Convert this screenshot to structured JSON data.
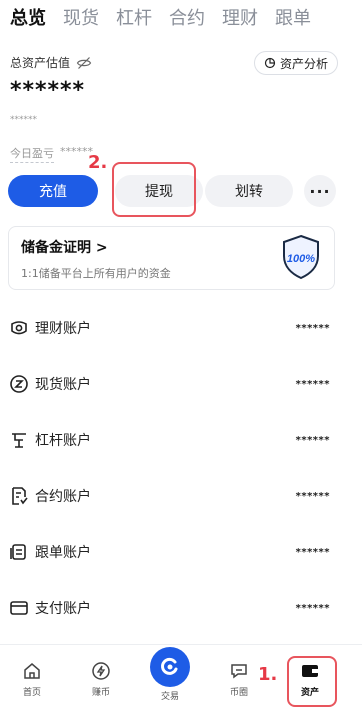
{
  "tabs": [
    "总览",
    "现货",
    "杠杆",
    "合约",
    "理财",
    "跟单"
  ],
  "summary": {
    "label": "总资产估值",
    "masked_total": "******",
    "masked_sub": "******",
    "pnl_label": "今日盈亏",
    "pnl_value": "******",
    "analysis_button": "资产分析"
  },
  "actions": {
    "recharge": "充值",
    "withdraw": "提现",
    "transfer": "划转",
    "more": "···"
  },
  "annotations": {
    "step1": "1.",
    "step2": "2."
  },
  "reserve": {
    "title": "储备金证明 >",
    "desc": "1:1储备平台上所有用户的资金",
    "badge": "100%"
  },
  "accounts": [
    {
      "label": "理财账户",
      "value": "******",
      "icon": "wealth-icon"
    },
    {
      "label": "现货账户",
      "value": "******",
      "icon": "spot-icon"
    },
    {
      "label": "杠杆账户",
      "value": "******",
      "icon": "margin-icon"
    },
    {
      "label": "合约账户",
      "value": "******",
      "icon": "futures-icon"
    },
    {
      "label": "跟单账户",
      "value": "******",
      "icon": "copytrade-icon"
    },
    {
      "label": "支付账户",
      "value": "******",
      "icon": "payment-icon"
    }
  ],
  "nav": {
    "home": "首页",
    "earn": "赚币",
    "trade": "交易",
    "community": "币圈",
    "assets": "资产"
  },
  "colors": {
    "accent": "#1e5ce6",
    "annotation": "#e63946"
  }
}
